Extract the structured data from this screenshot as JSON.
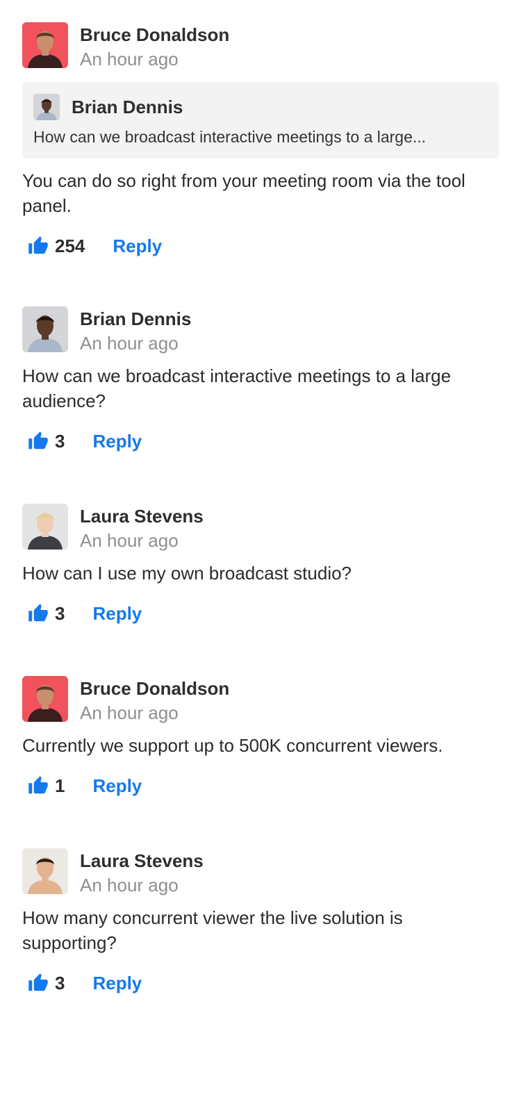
{
  "accent_color": "#1479ef",
  "comments": [
    {
      "author": "Bruce Donaldson",
      "time": "An hour ago",
      "avatar": {
        "icon": "avatar-photo",
        "bg": "#f2525b",
        "skin": "#c98f6e",
        "hair": "#5a3a26",
        "shirt": "#3a1f1f"
      },
      "quote": {
        "author": "Brian Dennis",
        "text": "How can we broadcast interactive meetings to a large...",
        "avatar": {
          "icon": "avatar-photo",
          "bg": "#d4d5d8",
          "skin": "#5a3a2a",
          "hair": "#1f1511",
          "shirt": "#a9b7c8"
        }
      },
      "text": "You can do so right from your meeting room via the tool panel.",
      "likes": "254",
      "reply_label": "Reply"
    },
    {
      "author": "Brian Dennis",
      "time": "An hour ago",
      "avatar": {
        "icon": "avatar-photo",
        "bg": "#d4d5d8",
        "skin": "#5a3a2a",
        "hair": "#1f1511",
        "shirt": "#a9b7c8"
      },
      "text": "How can we broadcast interactive meetings to a large audience?",
      "likes": "3",
      "reply_label": "Reply"
    },
    {
      "author": "Laura Stevens",
      "time": "An hour ago",
      "avatar": {
        "icon": "avatar-photo",
        "bg": "#e4e4e4",
        "skin": "#efcdb5",
        "hair": "#e6cf8e",
        "shirt": "#3d3f45"
      },
      "text": "How can I use my own broadcast studio?",
      "likes": "3",
      "reply_label": "Reply"
    },
    {
      "author": "Bruce Donaldson",
      "time": "An hour ago",
      "avatar": {
        "icon": "avatar-photo",
        "bg": "#f2525b",
        "skin": "#c98f6e",
        "hair": "#5a3a26",
        "shirt": "#3a1f1f"
      },
      "text": "Currently we support up to 500K concurrent viewers.",
      "likes": "1",
      "reply_label": "Reply"
    },
    {
      "author": "Laura Stevens",
      "time": "An hour ago",
      "avatar": {
        "icon": "avatar-photo",
        "bg": "#ece8e4",
        "skin": "#e3b390",
        "hair": "#2a1d16",
        "shirt": "#e3b390"
      },
      "text": "How many concurrent viewer the live solution is supporting?",
      "likes": "3",
      "reply_label": "Reply"
    }
  ]
}
